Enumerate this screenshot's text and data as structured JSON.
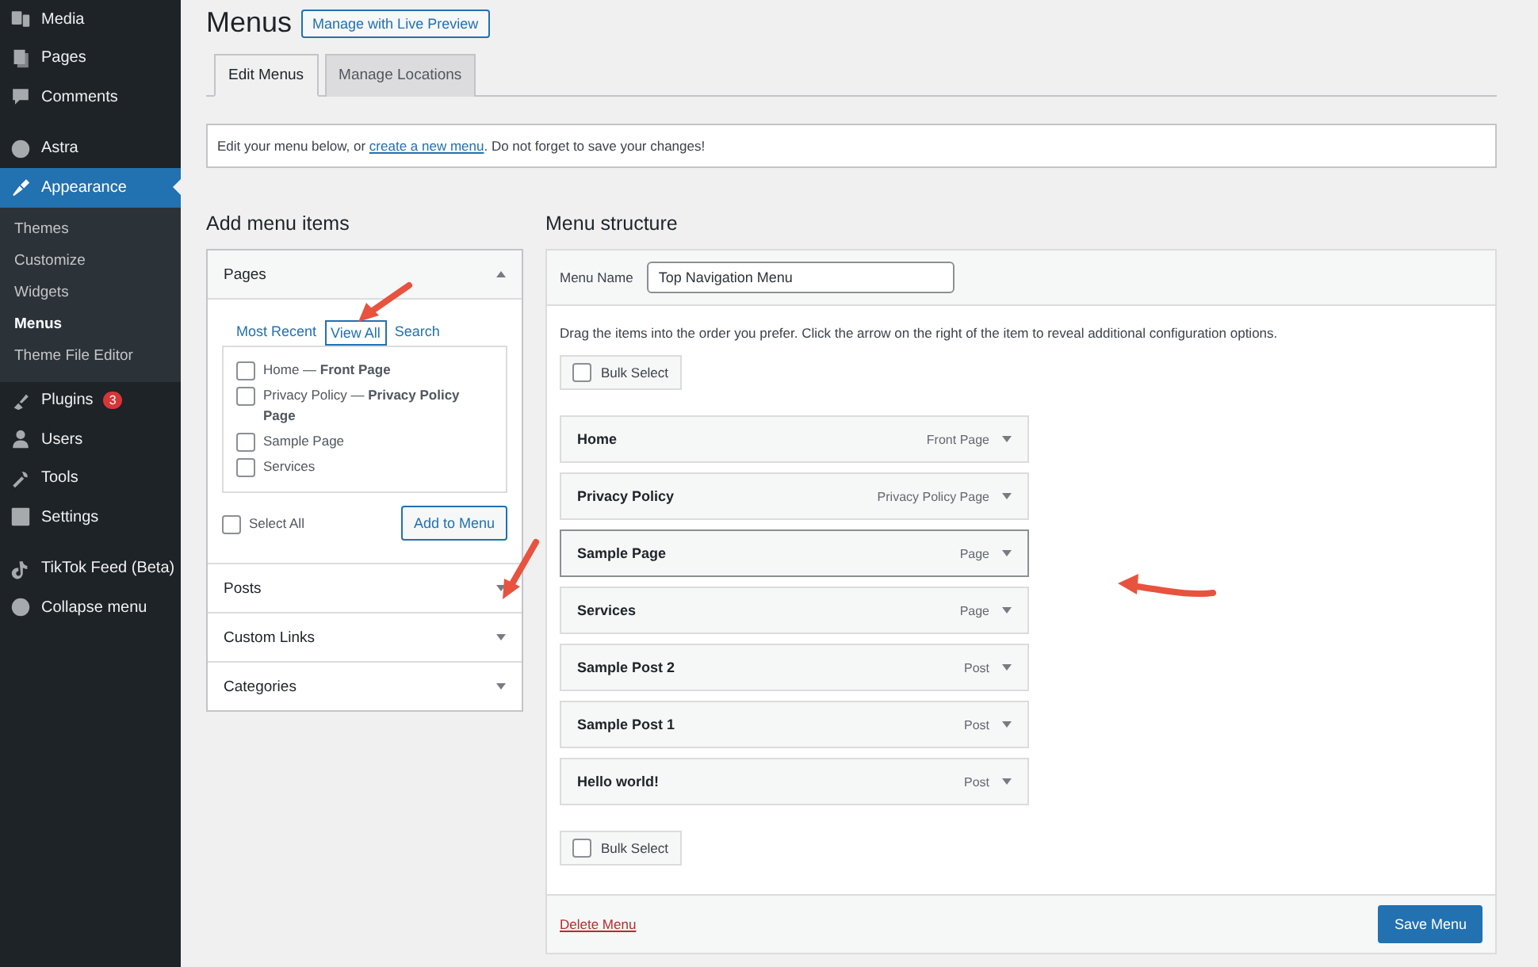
{
  "sidebar": {
    "groups": [
      [
        {
          "label": "Media",
          "selected": false
        },
        {
          "label": "Pages",
          "selected": false
        },
        {
          "label": "Comments",
          "selected": false
        }
      ],
      [
        {
          "label": "Astra",
          "selected": false
        },
        {
          "label": "Appearance",
          "selected": true,
          "children": [
            {
              "label": "Themes",
              "selected": false
            },
            {
              "label": "Customize",
              "selected": false
            },
            {
              "label": "Widgets",
              "selected": false
            },
            {
              "label": "Menus",
              "selected": true
            },
            {
              "label": "Theme File Editor",
              "selected": false
            }
          ]
        },
        {
          "label": "Plugins",
          "selected": false,
          "badge": "3"
        },
        {
          "label": "Users",
          "selected": false
        },
        {
          "label": "Tools",
          "selected": false
        },
        {
          "label": "Settings",
          "selected": false
        }
      ],
      [
        {
          "label": "TikTok Feed (Beta)",
          "selected": false
        },
        {
          "label": "Collapse menu",
          "selected": false
        }
      ]
    ]
  },
  "page": {
    "title": "Menus",
    "preview_button": "Manage with Live Preview"
  },
  "tabs": [
    {
      "label": "Edit Menus",
      "selected": true
    },
    {
      "label": "Manage Locations",
      "selected": false
    }
  ],
  "notice": {
    "before": "Edit your menu below, or ",
    "link": "create a new menu",
    "after": ". Do not forget to save your changes!"
  },
  "add_items": {
    "heading": "Add menu items",
    "sections": [
      {
        "title": "Pages",
        "expanded": true,
        "tabs": [
          {
            "label": "Most Recent",
            "selected": false
          },
          {
            "label": "View All",
            "selected": true
          },
          {
            "label": "Search",
            "selected": false
          }
        ],
        "items": [
          {
            "label": "Home — **Front Page**",
            "checked": false
          },
          {
            "label": "Privacy Policy — **Privacy Policy Page**",
            "checked": false
          },
          {
            "label": "Sample Page",
            "checked": false
          },
          {
            "label": "Services",
            "checked": false
          }
        ],
        "select_all": {
          "label": "Select All",
          "checked": false
        },
        "add_button": "Add to Menu"
      },
      {
        "title": "Posts",
        "expanded": false
      },
      {
        "title": "Custom Links",
        "expanded": false
      },
      {
        "title": "Categories",
        "expanded": false
      }
    ]
  },
  "structure": {
    "heading": "Menu structure",
    "name_label": "Menu Name",
    "name_value": "Top Navigation Menu",
    "instructions": "Drag the items into the order you prefer. Click the arrow on the right of the item to reveal additional configuration options.",
    "bulk_top": {
      "label": "Bulk Select",
      "checked": false
    },
    "items": [
      {
        "title": "Home",
        "type": "Front Page",
        "hovered": false
      },
      {
        "title": "Privacy Policy",
        "type": "Privacy Policy Page",
        "hovered": false
      },
      {
        "title": "Sample Page",
        "type": "Page",
        "hovered": true
      },
      {
        "title": "Services",
        "type": "Page",
        "hovered": false
      },
      {
        "title": "Sample Post 2",
        "type": "Post",
        "hovered": false
      },
      {
        "title": "Sample Post 1",
        "type": "Post",
        "hovered": false
      },
      {
        "title": "Hello world!",
        "type": "Post",
        "hovered": false
      }
    ],
    "bulk_bottom": {
      "label": "Bulk Select",
      "checked": false
    },
    "delete_link": "Delete Menu",
    "save_button": "Save Menu"
  }
}
